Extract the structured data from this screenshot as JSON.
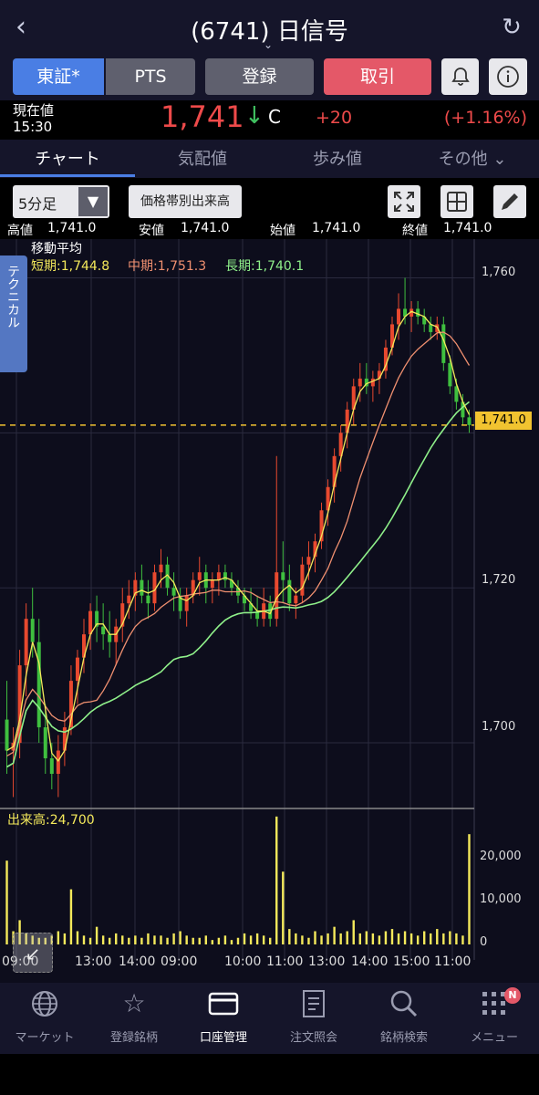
{
  "header": {
    "back_icon": "chevron-left-icon",
    "title": "(6741) 日信号",
    "caret_icon": "chevron-down-icon",
    "refresh_icon": "refresh-icon"
  },
  "actions": {
    "tosho": "東証*",
    "pts": "PTS",
    "register": "登録",
    "trade": "取引",
    "bell_icon": "bell-icon",
    "info_icon": "info-icon"
  },
  "price": {
    "label": "現在値",
    "time": "15:30",
    "value": "1,741",
    "direction_icon": "down-arrow-icon",
    "flag": "C",
    "change": "+20",
    "change_pct": "(+1.16%)"
  },
  "tabs": {
    "chart": "チャート",
    "quote": "気配値",
    "ticks": "歩み値",
    "other": "その他 ⌄"
  },
  "controls": {
    "interval": "5分足",
    "volume_profile": "価格帯別出来高",
    "expand_icon": "expand-icon",
    "grid_icon": "grid-icon",
    "draw_icon": "pencil-icon"
  },
  "ohlc": {
    "high_label": "高値",
    "high": "1,741.0",
    "low_label": "安値",
    "low": "1,741.0",
    "open_label": "始値",
    "open": "1,741.0",
    "close_label": "終値",
    "close": "1,741.0"
  },
  "technical": {
    "tab_label": "テクニカル",
    "ma_title": "移動平均",
    "ma_short": "短期:1,744.8",
    "ma_mid": "中期:1,751.3",
    "ma_long": "長期:1,740.1"
  },
  "last_price_tag": "1,741.0",
  "colors": {
    "up": "#e8492f",
    "down": "#3fbf3f",
    "ma_short": "#f4e95b",
    "ma_mid": "#f09070",
    "ma_long": "#8ff08a",
    "volume": "#f4e95b",
    "last_price_line": "#f1c330"
  },
  "volume": {
    "label": "出来高:24,700",
    "ticks": [
      "20,000",
      "10,000",
      "0"
    ]
  },
  "chart_data": {
    "type": "candlestick",
    "interval": "5分足",
    "y_ticks": [
      "1,760",
      "1,720",
      "1,700"
    ],
    "x_ticks": [
      "09:00",
      "11:00",
      "13:00",
      "14:00",
      "09:00",
      "10:00",
      "11:00",
      "13:00",
      "14:00",
      "15:00"
    ],
    "ylim": [
      1692,
      1765
    ],
    "last_price": 1741.0,
    "candles": [
      [
        1703,
        1708,
        1696,
        1699
      ],
      [
        1699,
        1702,
        1693,
        1700
      ],
      [
        1700,
        1712,
        1698,
        1710
      ],
      [
        1710,
        1718,
        1706,
        1716
      ],
      [
        1716,
        1720,
        1711,
        1713
      ],
      [
        1713,
        1716,
        1700,
        1702
      ],
      [
        1702,
        1705,
        1696,
        1698
      ],
      [
        1698,
        1700,
        1694,
        1696
      ],
      [
        1696,
        1701,
        1693,
        1699
      ],
      [
        1699,
        1704,
        1697,
        1702
      ],
      [
        1702,
        1710,
        1701,
        1708
      ],
      [
        1708,
        1712,
        1705,
        1711
      ],
      [
        1711,
        1716,
        1709,
        1714
      ],
      [
        1714,
        1718,
        1712,
        1717
      ],
      [
        1717,
        1719,
        1713,
        1715
      ],
      [
        1715,
        1718,
        1712,
        1714
      ],
      [
        1714,
        1717,
        1711,
        1713
      ],
      [
        1713,
        1716,
        1710,
        1715
      ],
      [
        1715,
        1720,
        1713,
        1718
      ],
      [
        1718,
        1721,
        1716,
        1719
      ],
      [
        1719,
        1722,
        1717,
        1721
      ],
      [
        1721,
        1723,
        1718,
        1719
      ],
      [
        1719,
        1721,
        1716,
        1718
      ],
      [
        1718,
        1723,
        1717,
        1722
      ],
      [
        1722,
        1725,
        1720,
        1723
      ],
      [
        1723,
        1724,
        1719,
        1720
      ],
      [
        1720,
        1722,
        1717,
        1719
      ],
      [
        1719,
        1720,
        1716,
        1717
      ],
      [
        1717,
        1720,
        1715,
        1719
      ],
      [
        1719,
        1722,
        1718,
        1721
      ],
      [
        1721,
        1724,
        1719,
        1722
      ],
      [
        1722,
        1723,
        1718,
        1720
      ],
      [
        1720,
        1722,
        1718,
        1721
      ],
      [
        1721,
        1723,
        1719,
        1722
      ],
      [
        1722,
        1723,
        1720,
        1721
      ],
      [
        1721,
        1722,
        1719,
        1720
      ],
      [
        1720,
        1721,
        1718,
        1719
      ],
      [
        1719,
        1720,
        1717,
        1718
      ],
      [
        1718,
        1720,
        1716,
        1717
      ],
      [
        1717,
        1719,
        1715,
        1716
      ],
      [
        1716,
        1720,
        1715,
        1718
      ],
      [
        1718,
        1719,
        1715,
        1716
      ],
      [
        1716,
        1737,
        1715,
        1722
      ],
      [
        1722,
        1726,
        1718,
        1721
      ],
      [
        1721,
        1723,
        1717,
        1718
      ],
      [
        1718,
        1720,
        1716,
        1719
      ],
      [
        1719,
        1724,
        1718,
        1723
      ],
      [
        1723,
        1726,
        1721,
        1724
      ],
      [
        1724,
        1727,
        1722,
        1726
      ],
      [
        1726,
        1731,
        1725,
        1730
      ],
      [
        1730,
        1734,
        1728,
        1733
      ],
      [
        1733,
        1738,
        1731,
        1737
      ],
      [
        1737,
        1741,
        1735,
        1740
      ],
      [
        1740,
        1744,
        1738,
        1743
      ],
      [
        1743,
        1747,
        1741,
        1746
      ],
      [
        1746,
        1749,
        1744,
        1747
      ],
      [
        1747,
        1749,
        1745,
        1746
      ],
      [
        1746,
        1748,
        1744,
        1747
      ],
      [
        1747,
        1749,
        1745,
        1748
      ],
      [
        1748,
        1752,
        1747,
        1751
      ],
      [
        1751,
        1755,
        1750,
        1754
      ],
      [
        1754,
        1758,
        1752,
        1756
      ],
      [
        1756,
        1760,
        1754,
        1755
      ],
      [
        1755,
        1757,
        1753,
        1756
      ],
      [
        1756,
        1757,
        1754,
        1755
      ],
      [
        1755,
        1756,
        1753,
        1754
      ],
      [
        1754,
        1755,
        1752,
        1753
      ],
      [
        1753,
        1755,
        1752,
        1754
      ],
      [
        1754,
        1755,
        1748,
        1749
      ],
      [
        1749,
        1750,
        1745,
        1746
      ],
      [
        1746,
        1747,
        1743,
        1744
      ],
      [
        1744,
        1745,
        1741,
        1742
      ],
      [
        1742,
        1743,
        1740,
        1741
      ]
    ],
    "volumes": [
      19000,
      3000,
      5500,
      2500,
      2000,
      1500,
      1500,
      2000,
      3000,
      2500,
      12500,
      3000,
      2000,
      1500,
      4000,
      2000,
      1500,
      2500,
      2000,
      1500,
      2000,
      1500,
      2500,
      2000,
      2000,
      1500,
      2500,
      3000,
      2000,
      1500,
      1500,
      2000,
      1000,
      1500,
      2000,
      1000,
      1500,
      2500,
      2000,
      2500,
      2000,
      1500,
      29000,
      16500,
      3500,
      2500,
      2000,
      1500,
      3000,
      2000,
      2500,
      4000,
      2500,
      3000,
      5500,
      2500,
      3000,
      2500,
      2000,
      3000,
      3500,
      2500,
      3000,
      2500,
      2000,
      3000,
      2500,
      3500,
      2500,
      3000,
      2500,
      2000,
      25000
    ]
  }
}
